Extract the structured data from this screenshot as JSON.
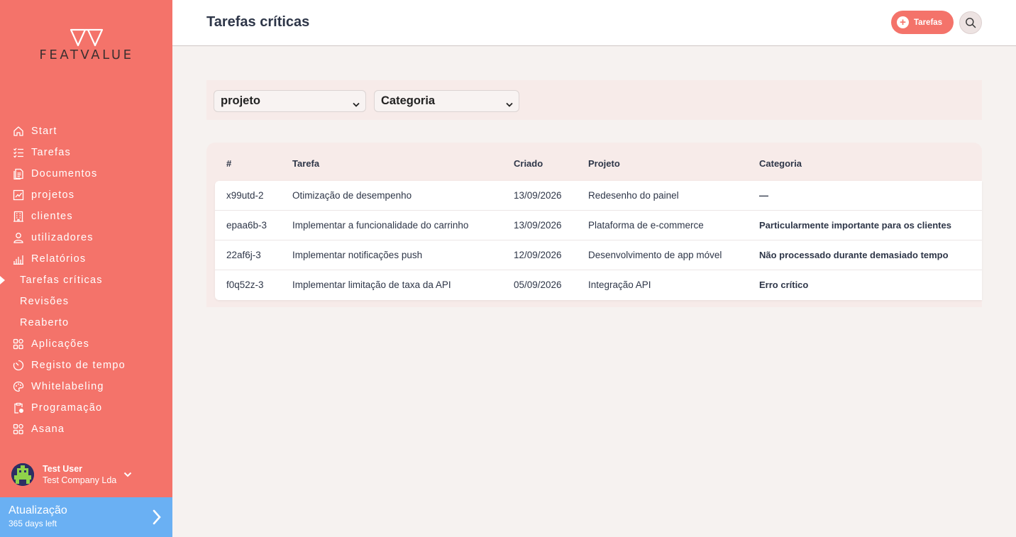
{
  "brand": {
    "logo_text": "FEATVALUE",
    "accent": "#f4736a",
    "upgrade_color": "#6ab0f3"
  },
  "sidebar": {
    "items": [
      {
        "label": "Start",
        "icon": "home-icon"
      },
      {
        "label": "Tarefas",
        "icon": "checklist-icon"
      },
      {
        "label": "Documentos",
        "icon": "documents-icon"
      },
      {
        "label": "projetos",
        "icon": "chart-icon"
      },
      {
        "label": "clientes",
        "icon": "building-icon"
      },
      {
        "label": "utilizadores",
        "icon": "user-icon"
      },
      {
        "label": "Relatórios",
        "icon": "bar-chart-icon"
      },
      {
        "label": "Tarefas críticas",
        "icon": "",
        "active": true
      },
      {
        "label": "Revisões",
        "icon": ""
      },
      {
        "label": "Reaberto",
        "icon": ""
      },
      {
        "label": "Aplicações",
        "icon": "apps-icon"
      },
      {
        "label": "Registo de tempo",
        "icon": "timer-icon"
      },
      {
        "label": "Whitelabeling",
        "icon": "palette-icon"
      },
      {
        "label": "Programação",
        "icon": "clipboard-clock-icon"
      },
      {
        "label": "Asana",
        "icon": "apps-icon"
      }
    ],
    "user": {
      "name": "Test User",
      "company": "Test Company Lda"
    },
    "upgrade": {
      "title": "Atualização",
      "subtitle": "365 days left"
    }
  },
  "header": {
    "title": "Tarefas críticas",
    "add_label": "Tarefas"
  },
  "filters": {
    "project_selected": "projeto",
    "category_selected": "Categoria"
  },
  "table": {
    "columns": [
      "#",
      "Tarefa",
      "Criado",
      "Projeto",
      "Categoria"
    ],
    "rows": [
      {
        "id": "x99utd-2",
        "task": "Otimização de desempenho",
        "created": "13/09/2026",
        "project": "Redesenho do painel",
        "category": "—"
      },
      {
        "id": "epaa6b-3",
        "task": "Implementar a funcionalidade do carrinho",
        "created": "13/09/2026",
        "project": "Plataforma de e-commerce",
        "category": "Particularmente importante para os clientes"
      },
      {
        "id": "22af6j-3",
        "task": "Implementar notificações push",
        "created": "12/09/2026",
        "project": "Desenvolvimento de app móvel",
        "category": "Não processado durante demasiado tempo"
      },
      {
        "id": "f0q52z-3",
        "task": "Implementar limitação de taxa da API",
        "created": "05/09/2026",
        "project": "Integração API",
        "category": "Erro crítico"
      }
    ]
  }
}
